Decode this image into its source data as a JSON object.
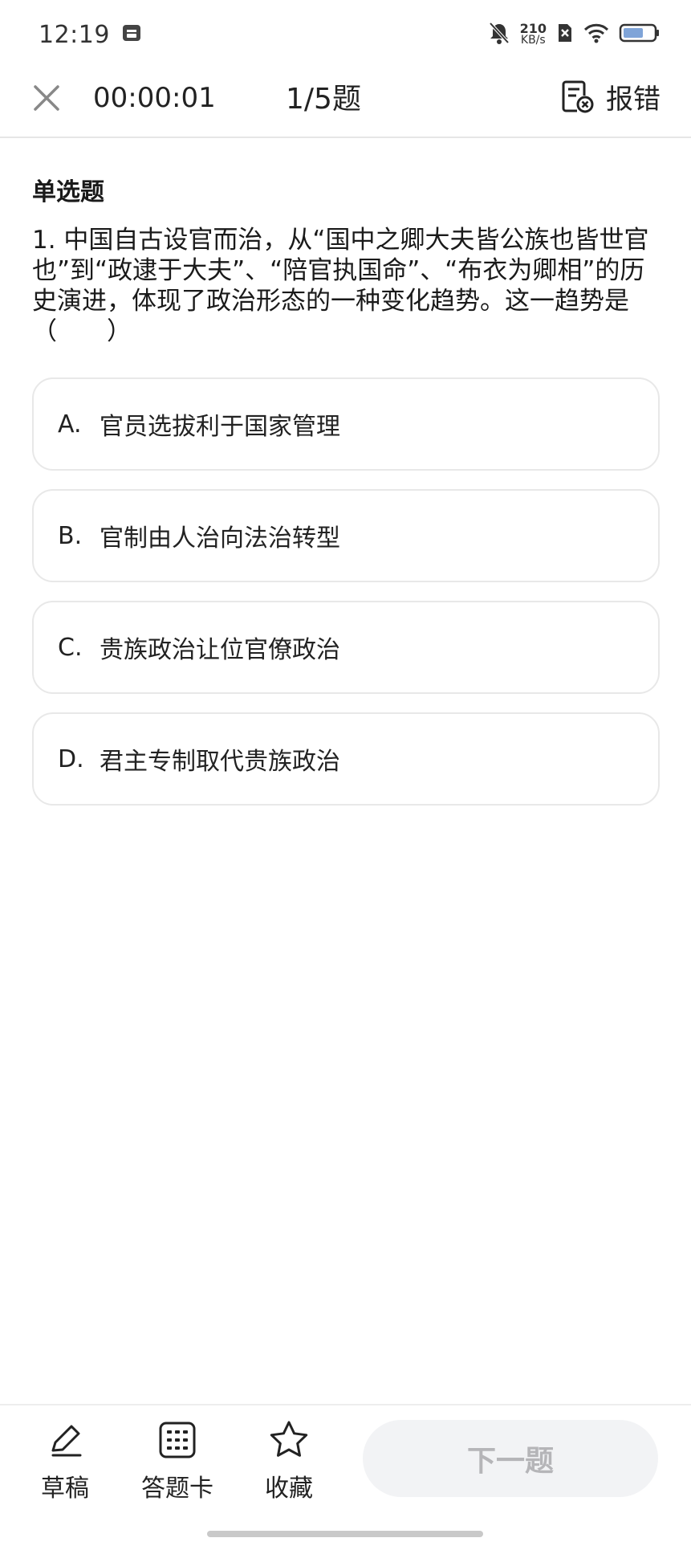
{
  "status_bar": {
    "time": "12:19",
    "net_speed_value": "210",
    "net_speed_unit": "KB/s"
  },
  "header": {
    "timer": "00:00:01",
    "progress": "1/5题",
    "report_label": "报错"
  },
  "question": {
    "type_label": "单选题",
    "text": "1.  中国自古设官而治，从“国中之卿大夫皆公族也皆世官也”到“政逮于大夫”、“陪官执国命”、“布衣为卿相”的历史演进，体现了政治形态的一种变化趋势。这一趋势是（　　）"
  },
  "options": [
    {
      "letter": "A.",
      "text": "官员选拔利于国家管理"
    },
    {
      "letter": "B.",
      "text": "官制由人治向法治转型"
    },
    {
      "letter": "C.",
      "text": "贵族政治让位官僚政治"
    },
    {
      "letter": "D.",
      "text": "君主专制取代贵族政治"
    }
  ],
  "toolbar": {
    "draft_label": "草稿",
    "answer_card_label": "答题卡",
    "favorite_label": "收藏",
    "next_label": "下一题"
  },
  "colors": {
    "option_border": "#e8e8e8",
    "next_button_bg": "#f2f3f5",
    "next_button_text": "#b5b5b8"
  }
}
